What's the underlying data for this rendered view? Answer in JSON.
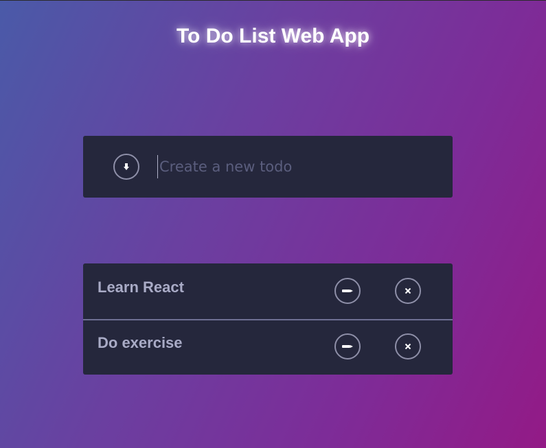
{
  "app": {
    "title": "To Do List Web App"
  },
  "new_todo": {
    "placeholder": "Create a new todo",
    "value": "",
    "submit_icon": "arrow-down-icon"
  },
  "todos": [
    {
      "text": "Learn React",
      "edit_icon": "pen-icon",
      "delete_icon": "close-icon"
    },
    {
      "text": "Do exercise",
      "edit_icon": "pen-icon",
      "delete_icon": "close-icon"
    }
  ],
  "colors": {
    "card": "#25273c",
    "button_border": "#8e8fa8",
    "todo_text": "#a9abc6",
    "placeholder": "#5b5e7e",
    "divider": "#6e6f93"
  }
}
